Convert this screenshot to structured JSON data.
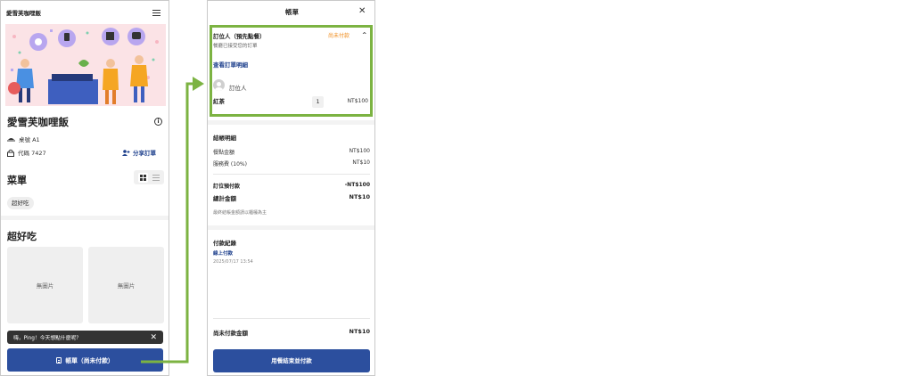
{
  "left": {
    "header_name": "愛雪芙咖哩飯",
    "restaurant_title": "愛雪芙咖哩飯",
    "table_label": "桌號 A1",
    "code_label": "代碼 7427",
    "share_label": "分享訂單",
    "menu_heading": "菜單",
    "category_chip": "超好吃",
    "category_heading": "超好吃",
    "no_image_1": "無圖片",
    "no_image_2": "無圖片",
    "toast_text": "嗨，Ping！今天想點什麼呢？",
    "bill_button": "帳單（尚未付款）"
  },
  "right": {
    "title": "帳單",
    "orderer_heading": "訂位人（預先點餐）",
    "status": "尚未付款",
    "subtitle": "餐廳已接受您的訂單",
    "view_details": "查看訂單明細",
    "user_name": "訂位人",
    "item_name": "紅茶",
    "item_qty": "1",
    "item_price": "NT$100",
    "summary_heading": "結帳明細",
    "meal_amount_label": "餐點金額",
    "meal_amount": "NT$100",
    "service_label": "服務費 (10%)",
    "service_amount": "NT$10",
    "prepaid_label": "訂位預付款",
    "prepaid_amount": "-NT$100",
    "total_label": "總計金額",
    "total_amount": "NT$10",
    "note": "最終結帳金額請以櫃檯為主",
    "payment_heading": "付款紀錄",
    "payment_type": "線上付款",
    "payment_date": "2025/07/17 13:54",
    "unpaid_label": "尚未付款金額",
    "unpaid_amount": "NT$10",
    "checkout_button": "用餐結束並付款"
  },
  "colors": {
    "primary_blue": "#2c4f9e",
    "link_blue": "#1d3f8c",
    "status_orange": "#f08c1c",
    "highlight_green": "#7cb342"
  }
}
